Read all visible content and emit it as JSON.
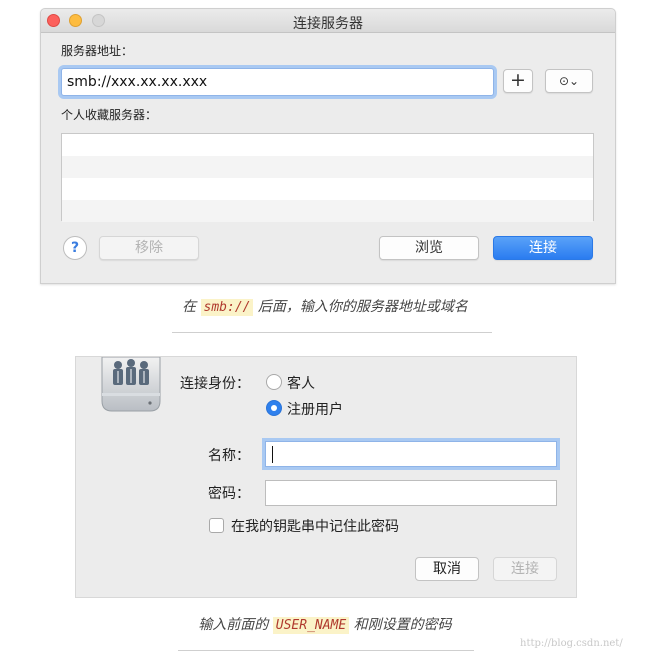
{
  "connect_window": {
    "title": "连接服务器",
    "address_label": "服务器地址：",
    "address_value": "smb://xxx.xx.xx.xxx",
    "plus_label": "+",
    "recent_label": "⊙⌄",
    "favorites_label": "个人收藏服务器：",
    "help_label": "?",
    "remove_label": "移除",
    "browse_label": "浏览",
    "connect_label": "连接"
  },
  "caption1": {
    "prefix": "在 ",
    "code": "smb://",
    "suffix": " 后面，输入你的服务器地址或域名"
  },
  "login_window": {
    "identity_label": "连接身份：",
    "guest_label": "客人",
    "registered_label": "注册用户",
    "selected_identity": "注册用户",
    "name_label": "名称：",
    "name_value": "",
    "password_label": "密码：",
    "password_value": "",
    "remember_label": "在我的钥匙串中记住此密码",
    "remember_checked": false,
    "cancel_label": "取消",
    "connect_label": "连接"
  },
  "caption2": {
    "prefix": "输入前面的 ",
    "code": "USER_NAME",
    "suffix": " 和刚设置的密码"
  },
  "watermark": "http://blog.csdn.net/",
  "colors": {
    "accent_blue": "#2f80ed",
    "close_red": "#fc605c",
    "minimize_yellow": "#fdbc40",
    "code_highlight": "#fbf3c8"
  }
}
